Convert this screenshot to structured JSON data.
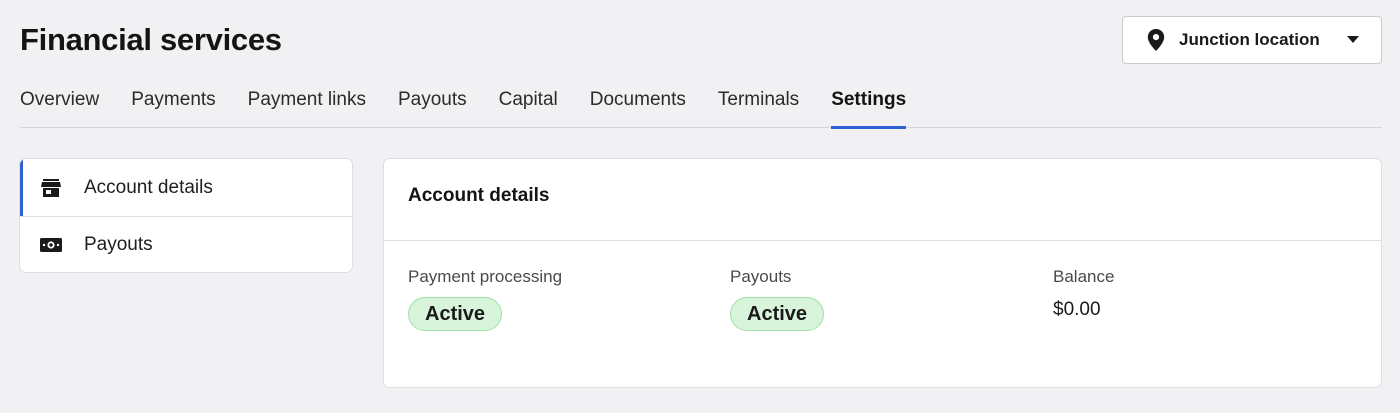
{
  "header": {
    "title": "Financial services",
    "location_button_label": "Junction location"
  },
  "tabs": [
    {
      "label": "Overview"
    },
    {
      "label": "Payments"
    },
    {
      "label": "Payment links"
    },
    {
      "label": "Payouts"
    },
    {
      "label": "Capital"
    },
    {
      "label": "Documents"
    },
    {
      "label": "Terminals"
    },
    {
      "label": "Settings",
      "active": true
    }
  ],
  "sidebar": {
    "items": [
      {
        "label": "Account details",
        "icon": "storefront-icon",
        "active": true
      },
      {
        "label": "Payouts",
        "icon": "cash-icon"
      }
    ]
  },
  "account_details": {
    "title": "Account details",
    "payment_processing": {
      "label": "Payment processing",
      "status": "Active"
    },
    "payouts": {
      "label": "Payouts",
      "status": "Active"
    },
    "balance": {
      "label": "Balance",
      "value": "$0.00"
    }
  },
  "colors": {
    "accent": "#2f5fd0",
    "status_active_bg": "#d8f5dc",
    "status_active_border": "#9ee0a8",
    "page_bg": "#f1f1f4"
  }
}
